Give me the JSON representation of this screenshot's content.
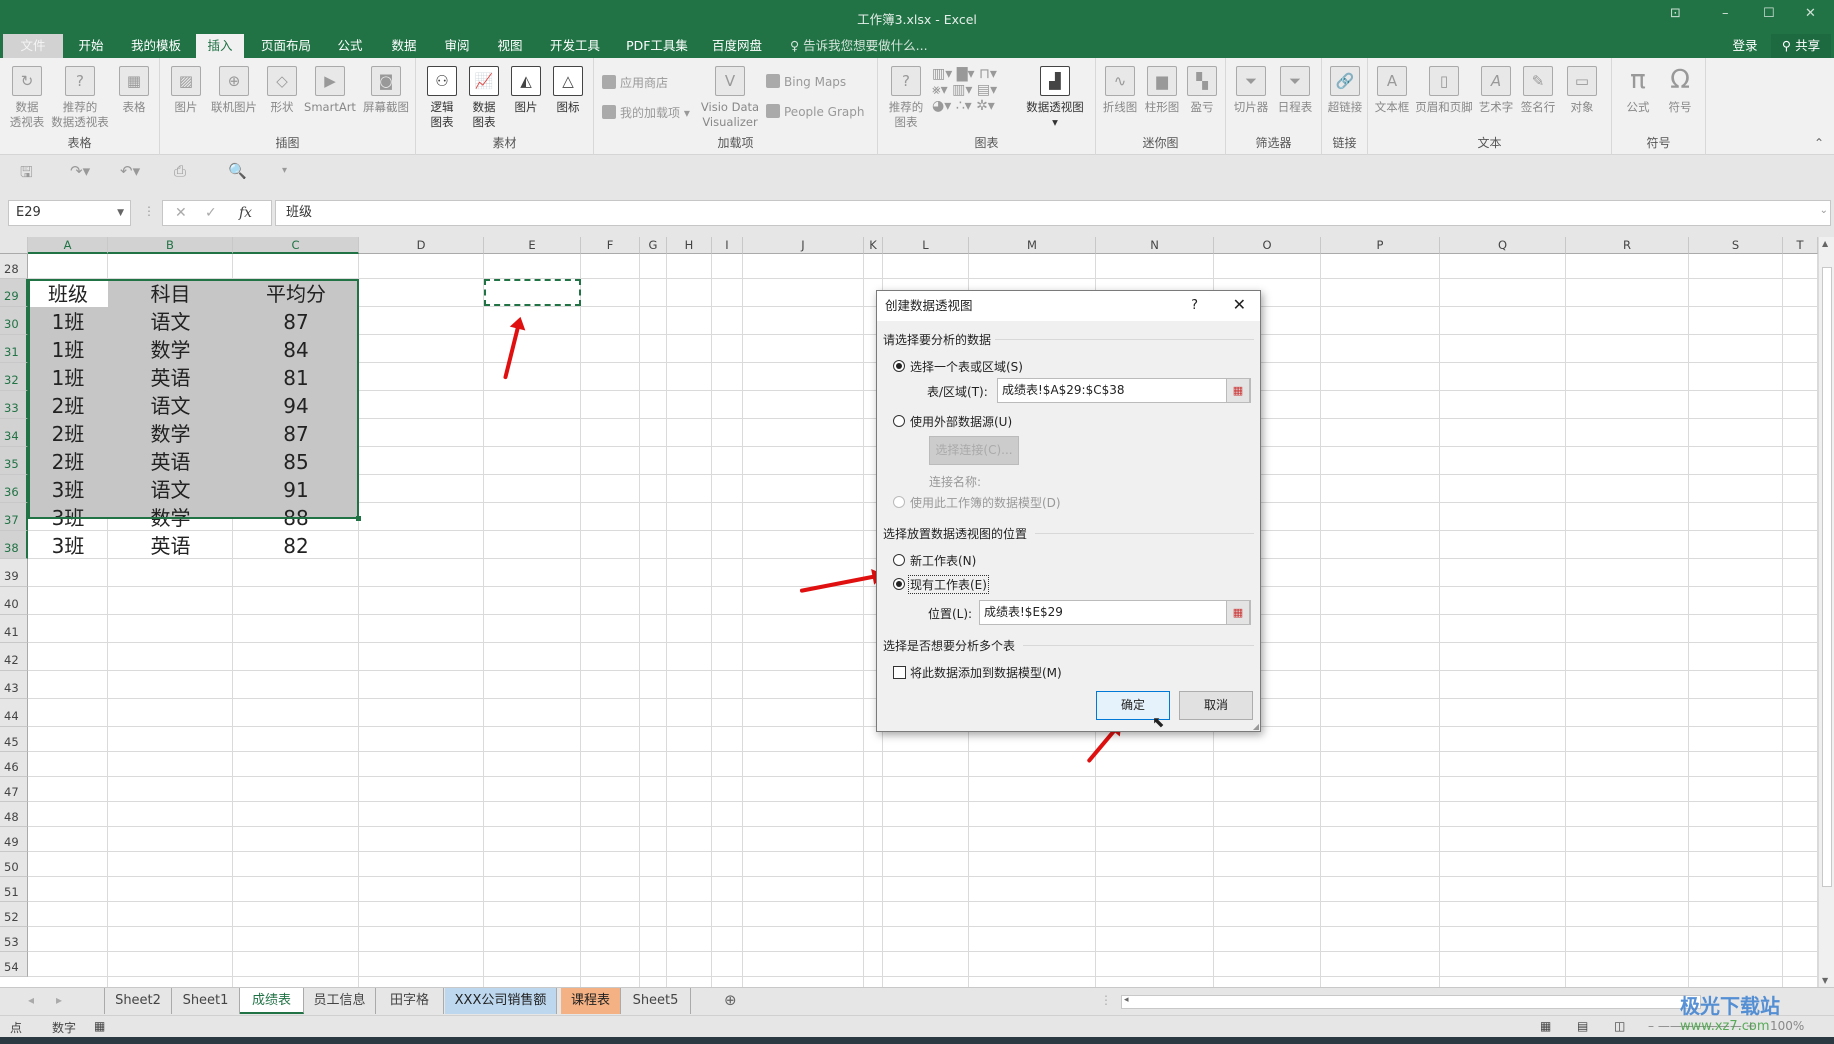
{
  "window": {
    "title": "工作簿3.xlsx - Excel",
    "controls": [
      "ribbon-display-icon",
      "minimize-icon",
      "maximize-icon",
      "close-icon"
    ]
  },
  "menu": {
    "tabs": [
      "文件",
      "开始",
      "我的模板",
      "插入",
      "页面布局",
      "公式",
      "数据",
      "审阅",
      "视图",
      "开发工具",
      "PDF工具集",
      "百度网盘"
    ],
    "active_tab": "插入",
    "tell_me": "告诉我您想要做什么...",
    "login": "登录",
    "share": "共享"
  },
  "ribbon": {
    "groups": [
      {
        "label": "表格",
        "buttons": [
          "数据\n透视表",
          "推荐的\n数据透视表",
          "表格"
        ]
      },
      {
        "label": "插图",
        "buttons": [
          "图片",
          "联机图片",
          "形状",
          "SmartArt",
          "屏幕截图"
        ]
      },
      {
        "label": "素材",
        "buttons": [
          "逻辑\n图表",
          "数据\n图表",
          "图片",
          "图标"
        ]
      },
      {
        "label": "加载项",
        "buttons": [
          "应用商店",
          "我的加载项",
          "Visio Data\nVisualizer",
          "Bing Maps",
          "People Graph"
        ]
      },
      {
        "label": "图表",
        "buttons": [
          "推荐的\n图表",
          "数据透视图"
        ]
      },
      {
        "label": "迷你图",
        "buttons": [
          "折线图",
          "柱形图",
          "盈亏"
        ]
      },
      {
        "label": "筛选器",
        "buttons": [
          "切片器",
          "日程表"
        ]
      },
      {
        "label": "链接",
        "buttons": [
          "超链接"
        ]
      },
      {
        "label": "文本",
        "buttons": [
          "文本框",
          "页眉和页脚",
          "艺术字",
          "签名行",
          "对象"
        ]
      },
      {
        "label": "符号",
        "buttons": [
          "公式",
          "符号"
        ]
      }
    ]
  },
  "formula_bar": {
    "name_box": "E29",
    "formula": "班级"
  },
  "sheet": {
    "columns": [
      "A",
      "B",
      "C",
      "D",
      "E",
      "F",
      "G",
      "H",
      "I",
      "J",
      "K",
      "L",
      "M",
      "N",
      "O",
      "P",
      "Q",
      "R",
      "S",
      "T"
    ],
    "rows": [
      "28",
      "29",
      "30",
      "31",
      "32",
      "33",
      "34",
      "35",
      "36",
      "37",
      "38",
      "39",
      "40",
      "41",
      "42",
      "43",
      "44",
      "45",
      "46",
      "47",
      "48",
      "49",
      "50",
      "51",
      "52",
      "53",
      "54"
    ],
    "table": {
      "headers": [
        "班级",
        "科目",
        "平均分"
      ],
      "rows": [
        [
          "1班",
          "语文",
          "87"
        ],
        [
          "1班",
          "数学",
          "84"
        ],
        [
          "1班",
          "英语",
          "81"
        ],
        [
          "2班",
          "语文",
          "94"
        ],
        [
          "2班",
          "数学",
          "87"
        ],
        [
          "2班",
          "英语",
          "85"
        ],
        [
          "3班",
          "语文",
          "91"
        ],
        [
          "3班",
          "数学",
          "88"
        ],
        [
          "3班",
          "英语",
          "82"
        ]
      ]
    }
  },
  "dialog": {
    "title": "创建数据透视图",
    "help": "?",
    "section1": "请选择要分析的数据",
    "opt_table": "选择一个表或区域(S)",
    "range_label": "表/区域(T):",
    "range_value": "成绩表!$A$29:$C$38",
    "opt_external": "使用外部数据源(U)",
    "choose_conn": "选择连接(C)...",
    "conn_name": "连接名称:",
    "opt_model": "使用此工作簿的数据模型(D)",
    "section2": "选择放置数据透视图的位置",
    "opt_new": "新工作表(N)",
    "opt_existing": "现有工作表(E)",
    "location_label": "位置(L):",
    "location_value": "成绩表!$E$29",
    "section3": "选择是否想要分析多个表",
    "add_model": "将此数据添加到数据模型(M)",
    "ok": "确定",
    "cancel": "取消",
    "selected_source": "选择一个表或区域(S)",
    "selected_location": "现有工作表(E)",
    "add_model_checked": false
  },
  "sheet_tabs": {
    "tabs": [
      "Sheet2",
      "Sheet1",
      "成绩表",
      "员工信息",
      "田字格",
      "XXX公司销售额",
      "课程表",
      "Sheet5"
    ],
    "active": "成绩表",
    "tab_colors": {
      "XXX公司销售额": "#bdd7ee",
      "课程表": "#f4b183"
    }
  },
  "status": {
    "mode": "点",
    "num": "数字",
    "zoom": "100%"
  },
  "watermark": {
    "name": "极光下载站",
    "url": "www.xz7.com"
  },
  "colors": {
    "accent": "#217346",
    "selection_fill": "#c6c6c6",
    "annotation_arrow": "#e01010",
    "primary_button_border": "#0078d7"
  }
}
